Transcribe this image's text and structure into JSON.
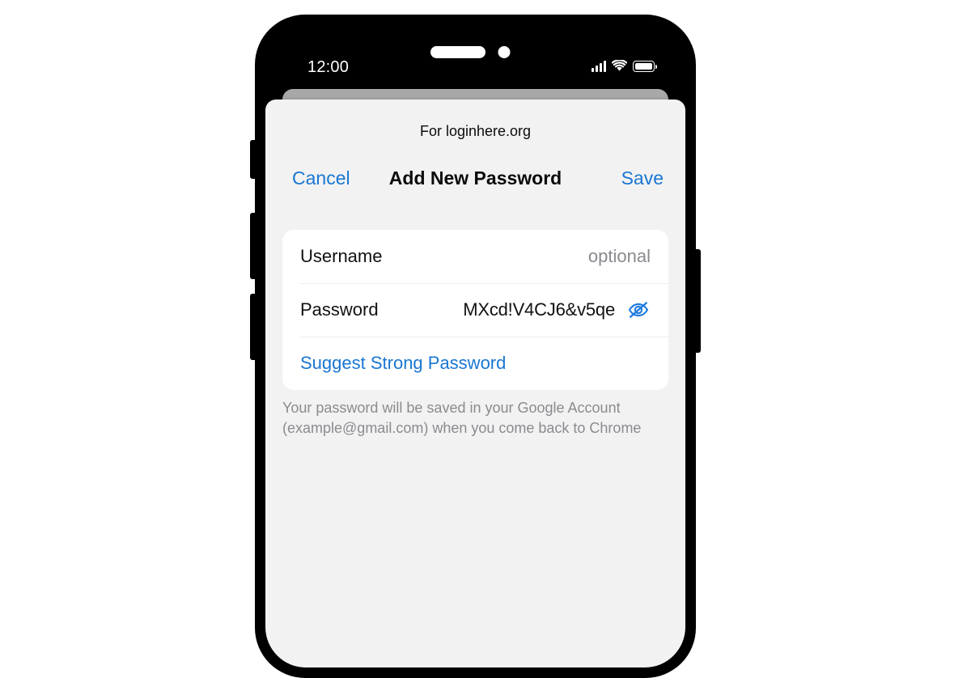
{
  "device": {
    "type": "smartphone",
    "status_bar": {
      "time": "12:00",
      "icons": [
        "cellular-signal-icon",
        "wifi-icon",
        "battery-icon"
      ],
      "battery_level_percent": 100,
      "signal_bars": 4
    },
    "hardware_buttons": [
      "mute-switch",
      "volume-up",
      "volume-down",
      "power"
    ]
  },
  "sheet": {
    "subtitle": "For loginhere.org",
    "toolbar": {
      "cancel_label": "Cancel",
      "title": "Add New Password",
      "save_label": "Save"
    },
    "form": {
      "rows": [
        {
          "name": "username",
          "label": "Username",
          "value": "",
          "placeholder": "optional"
        },
        {
          "name": "password",
          "label": "Password",
          "value": "MXcd!V4CJ6&v5qe",
          "placeholder": "",
          "visibility_icon": "eye-slash-icon",
          "visibility_state": "visible"
        }
      ],
      "suggest_label": "Suggest Strong Password"
    },
    "footer_note": "Your password will be saved in your Google Account (example@gmail.com) when you come back to Chrome"
  },
  "colors": {
    "accent_blue": "#1976d2",
    "sheet_background": "#f2f2f2",
    "card_background": "#ffffff",
    "primary_text": "#111111",
    "muted_text": "#8b8b90",
    "placeholder_text": "#8a8a8f",
    "device_body": "#000000",
    "backdrop_sheet": "#a8a8a8"
  }
}
